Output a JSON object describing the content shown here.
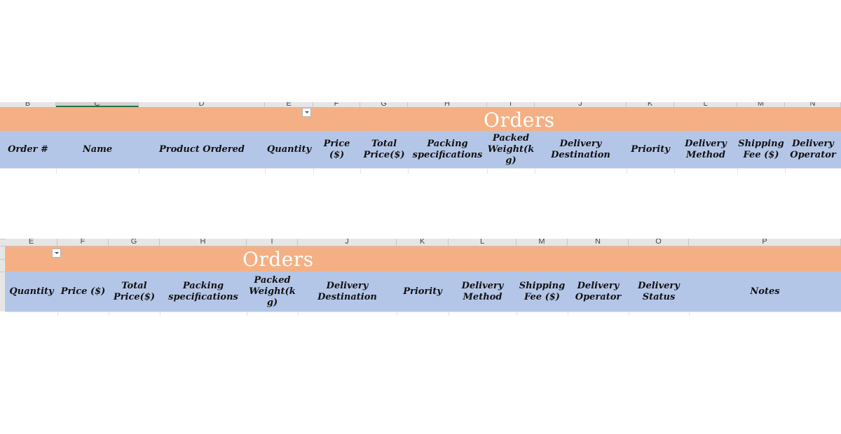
{
  "top_view": {
    "title": "Orders",
    "columns": [
      {
        "letter": "B",
        "header": "Order #"
      },
      {
        "letter": "C",
        "header": "Name",
        "selected": true
      },
      {
        "letter": "D",
        "header": "Product Ordered"
      },
      {
        "letter": "E",
        "header": "Quantity"
      },
      {
        "letter": "F",
        "header": "Price ($)"
      },
      {
        "letter": "G",
        "header": "Total Price($)"
      },
      {
        "letter": "H",
        "header": "Packing specifications"
      },
      {
        "letter": "I",
        "header": "Packed Weight(kg)"
      },
      {
        "letter": "J",
        "header": "Delivery Destination"
      },
      {
        "letter": "K",
        "header": "Priority"
      },
      {
        "letter": "L",
        "header": "Delivery Method"
      },
      {
        "letter": "M",
        "header": "Shipping Fee ($)"
      },
      {
        "letter": "N",
        "header": "Delivery Operator"
      }
    ]
  },
  "bottom_view": {
    "title": "Orders",
    "columns": [
      {
        "letter": "E",
        "header": "Quantity"
      },
      {
        "letter": "F",
        "header": "Price ($)"
      },
      {
        "letter": "G",
        "header": "Total Price($)"
      },
      {
        "letter": "H",
        "header": "Packing specifications"
      },
      {
        "letter": "I",
        "header": "Packed Weight(kg)"
      },
      {
        "letter": "J",
        "header": "Delivery Destination"
      },
      {
        "letter": "K",
        "header": "Priority"
      },
      {
        "letter": "L",
        "header": "Delivery Method"
      },
      {
        "letter": "M",
        "header": "Shipping Fee ($)"
      },
      {
        "letter": "N",
        "header": "Delivery Operator"
      },
      {
        "letter": "O",
        "header": "Delivery Status"
      },
      {
        "letter": "P",
        "header": "Notes"
      }
    ]
  },
  "icons": {
    "filter": "filter-dropdown-icon"
  },
  "colors": {
    "title_band": "#f4b084",
    "header_row": "#b4c6e7",
    "title_text": "#ffffff"
  }
}
